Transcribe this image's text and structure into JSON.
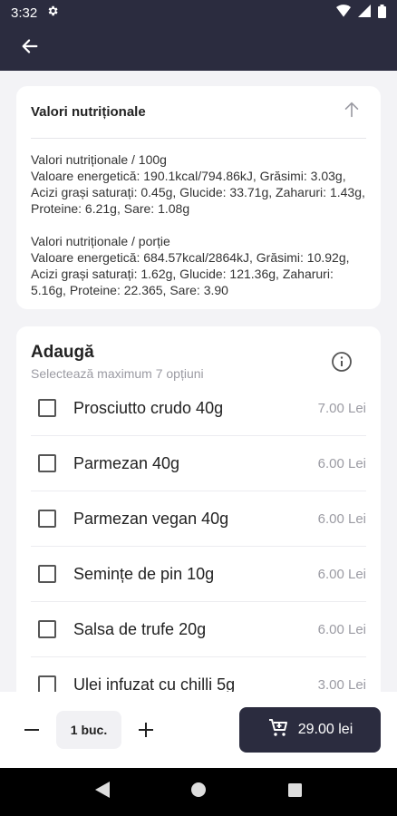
{
  "status_bar": {
    "time": "3:32",
    "icons": [
      "settings-icon",
      "wifi-icon",
      "signal-icon",
      "battery-icon"
    ]
  },
  "app_bar": {
    "back_icon": "arrow-left-icon"
  },
  "nutrition": {
    "title": "Valori nutriționale",
    "per_100g_title": "Valori nutriționale / 100g",
    "per_100g_text": "Valoare energetică: 190.1kcal/794.86kJ, Grăsimi: 3.03g, Acizi grași saturați: 0.45g, Glucide: 33.71g, Zaharuri: 1.43g, Proteine: 6.21g, Sare: 1.08g",
    "per_portion_title": "Valori nutriționale / porție",
    "per_portion_text": "Valoare energetică: 684.57kcal/2864kJ, Grăsimi: 10.92g, Acizi grași saturați: 1.62g, Glucide: 121.36g, Zaharuri: 5.16g, Proteine: 22.365, Sare: 3.90"
  },
  "add_section": {
    "title": "Adaugă",
    "subtitle": "Selectează maximum 7 opțiuni",
    "options": [
      {
        "label": "Prosciutto crudo 40g",
        "price": "7.00 Lei",
        "checked": false
      },
      {
        "label": "Parmezan 40g",
        "price": "6.00 Lei",
        "checked": false
      },
      {
        "label": "Parmezan vegan 40g",
        "price": "6.00 Lei",
        "checked": false
      },
      {
        "label": "Semințe de pin 10g",
        "price": "6.00 Lei",
        "checked": false
      },
      {
        "label": "Salsa de trufe 20g",
        "price": "6.00 Lei",
        "checked": false
      },
      {
        "label": "Ulei infuzat cu chilli 5g",
        "price": "3.00 Lei",
        "checked": false
      }
    ]
  },
  "bottom_bar": {
    "quantity": "1 buc.",
    "cart_total": "29.00 lei",
    "accent_color": "#2b2c3f"
  }
}
